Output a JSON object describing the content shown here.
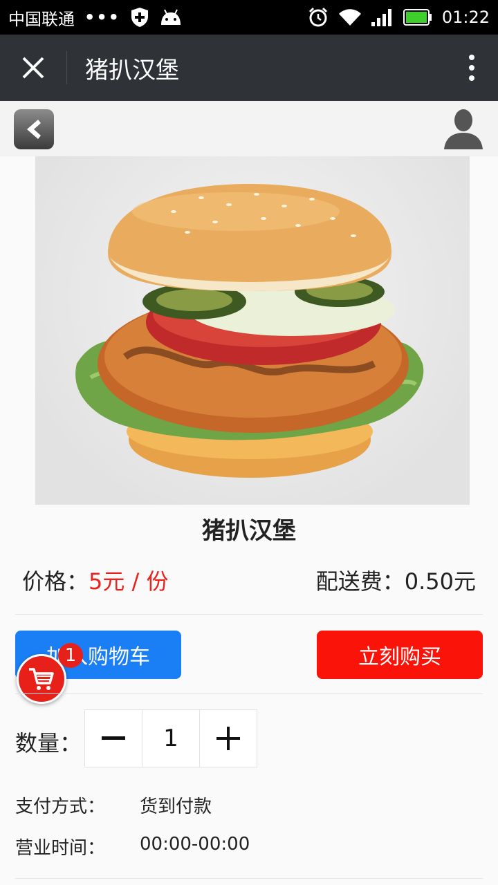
{
  "status_bar": {
    "carrier": "中国联通",
    "dots": "•••",
    "time": "01:22"
  },
  "title_bar": {
    "title": "猪扒汉堡"
  },
  "product": {
    "name": "猪扒汉堡",
    "price_label": "价格：",
    "price_value": "5元 / 份",
    "delivery_label": "配送费：",
    "delivery_value": "0.50元"
  },
  "actions": {
    "add_to_cart": "加入购物车",
    "buy_now": "立刻购买",
    "cart_count": "1"
  },
  "quantity": {
    "label": "数量：",
    "minus": "−",
    "value": "1",
    "plus": "+"
  },
  "details": {
    "payment_label": "支付方式：",
    "payment_value": "货到付款",
    "hours_label": "营业时间：",
    "hours_value": "00:00-00:00"
  },
  "colors": {
    "title_bar": "#2f3236",
    "price": "#e8221c",
    "add_cart_button": "#1a7ef5",
    "buy_button": "#fa1308"
  }
}
